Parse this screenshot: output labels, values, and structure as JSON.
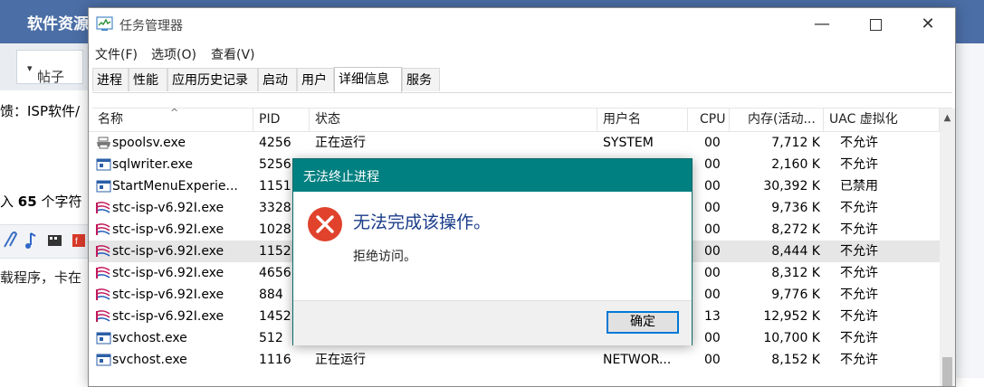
{
  "background_page": {
    "site_title": "软件资源",
    "posts_dropdown": "帖子",
    "line1": "馈：ISP软件/",
    "line2_prefix": "入",
    "line2_count": "65",
    "line2_suffix": "个字符",
    "line3": "载程序，卡在"
  },
  "task_manager": {
    "title": "任务管理器",
    "menu": [
      "文件(F)",
      "选项(O)",
      "查看(V)"
    ],
    "tabs": [
      "进程",
      "性能",
      "应用历史记录",
      "启动",
      "用户",
      "详细信息",
      "服务"
    ],
    "active_tab": "详细信息",
    "columns": {
      "name": "名称",
      "pid": "PID",
      "status": "状态",
      "user": "用户名",
      "cpu": "CPU",
      "memory": "内存(活动...",
      "uac": "UAC 虚拟化"
    },
    "rows": [
      {
        "icon": "printer-icon",
        "name": "spoolsv.exe",
        "pid": "4256",
        "status": "正在运行",
        "user": "SYSTEM",
        "cpu": "00",
        "memory": "7,712 K",
        "uac": "不允许"
      },
      {
        "icon": "app-window-icon",
        "name": "sqlwriter.exe",
        "pid": "5256",
        "status": "",
        "user": "",
        "cpu": "00",
        "memory": "2,160 K",
        "uac": "不允许"
      },
      {
        "icon": "app-window-icon",
        "name": "StartMenuExperie...",
        "pid": "1151",
        "status": "",
        "user": "",
        "cpu": "00",
        "memory": "30,392 K",
        "uac": "已禁用"
      },
      {
        "icon": "stc-isp-icon",
        "name": "stc-isp-v6.92I.exe",
        "pid": "3328",
        "status": "",
        "user": "",
        "cpu": "00",
        "memory": "9,736 K",
        "uac": "不允许"
      },
      {
        "icon": "stc-isp-icon",
        "name": "stc-isp-v6.92I.exe",
        "pid": "1028",
        "status": "",
        "user": "",
        "cpu": "00",
        "memory": "8,272 K",
        "uac": "不允许"
      },
      {
        "icon": "stc-isp-icon",
        "name": "stc-isp-v6.92I.exe",
        "pid": "1152",
        "status": "",
        "user": "",
        "cpu": "00",
        "memory": "8,444 K",
        "uac": "不允许",
        "selected": true
      },
      {
        "icon": "stc-isp-icon",
        "name": "stc-isp-v6.92I.exe",
        "pid": "4656",
        "status": "",
        "user": "",
        "cpu": "00",
        "memory": "8,312 K",
        "uac": "不允许"
      },
      {
        "icon": "stc-isp-icon",
        "name": "stc-isp-v6.92I.exe",
        "pid": "884",
        "status": "",
        "user": "",
        "cpu": "00",
        "memory": "9,776 K",
        "uac": "不允许"
      },
      {
        "icon": "stc-isp-icon",
        "name": "stc-isp-v6.92I.exe",
        "pid": "1452",
        "status": "",
        "user": "",
        "cpu": "13",
        "memory": "12,952 K",
        "uac": "不允许"
      },
      {
        "icon": "app-window-icon",
        "name": "svchost.exe",
        "pid": "512",
        "status": "",
        "user": "",
        "cpu": "00",
        "memory": "10,700 K",
        "uac": "不允许"
      },
      {
        "icon": "app-window-icon",
        "name": "svchost.exe",
        "pid": "1116",
        "status": "正在运行",
        "user": "NETWOR...",
        "cpu": "00",
        "memory": "8,152 K",
        "uac": "不允许"
      }
    ]
  },
  "error_dialog": {
    "title": "无法终止进程",
    "message": "无法完成该操作。",
    "detail": "拒绝访问。",
    "ok_label": "确定"
  },
  "colors": {
    "dialog_title_bg": "#008080",
    "dialog_message": "#1a3c8a",
    "error_icon": "#e0422c",
    "button_focus": "#0078d7",
    "web_header": "#4b6ea6"
  }
}
